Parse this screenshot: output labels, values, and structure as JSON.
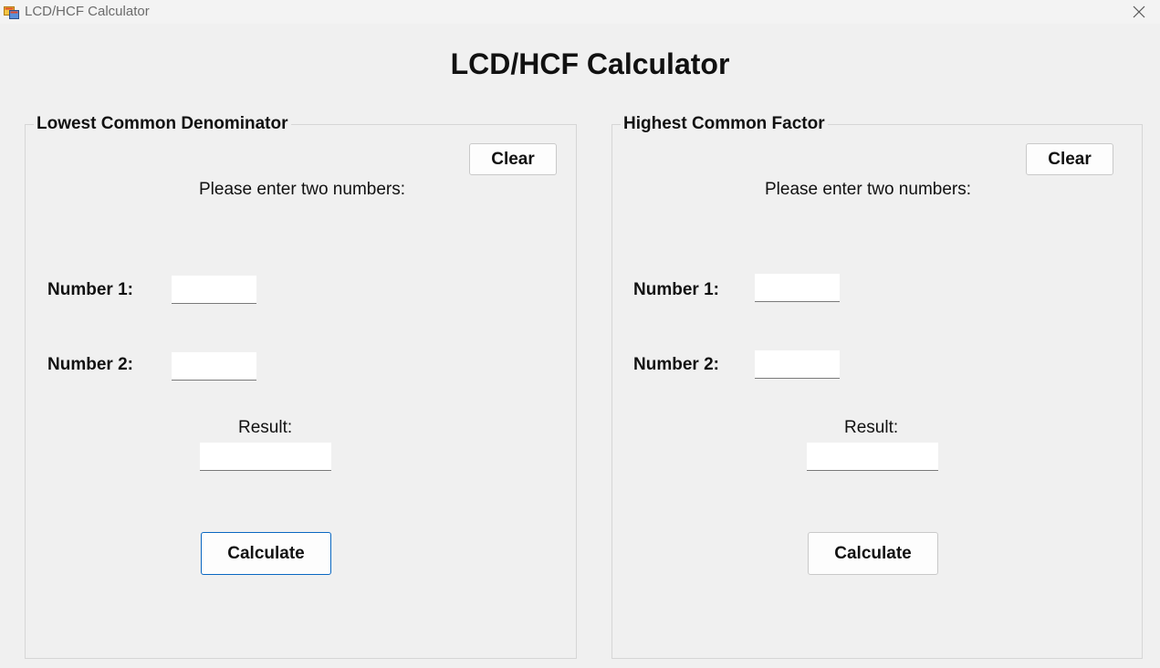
{
  "window": {
    "title": "LCD/HCF Calculator",
    "icon": "winforms-app-icon",
    "close_icon": "close-icon"
  },
  "heading": "LCD/HCF Calculator",
  "lcd": {
    "group_title": "Lowest Common Denominator",
    "clear_label": "Clear",
    "instruction": "Please enter two numbers:",
    "number1_label": "Number 1:",
    "number1_value": "",
    "number2_label": "Number 2:",
    "number2_value": "",
    "result_label": "Result:",
    "result_value": "",
    "calculate_label": "Calculate"
  },
  "hcf": {
    "group_title": "Highest Common Factor",
    "clear_label": "Clear",
    "instruction": "Please enter two numbers:",
    "number1_label": "Number 1:",
    "number1_value": "",
    "number2_label": "Number 2:",
    "number2_value": "",
    "result_label": "Result:",
    "result_value": "",
    "calculate_label": "Calculate"
  },
  "colors": {
    "background": "#f0f0f0",
    "focus_border": "#0a67c2",
    "group_border": "#d6d6d6"
  }
}
